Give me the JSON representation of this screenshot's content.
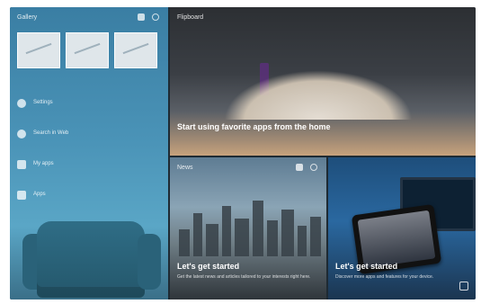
{
  "left_panel": {
    "title": "Gallery",
    "thumbnail_caption": "",
    "items": [
      {
        "label": "Settings",
        "sublabel": ""
      },
      {
        "label": "Search in Web",
        "sublabel": ""
      },
      {
        "label": "My apps",
        "sublabel": ""
      },
      {
        "label": "Apps",
        "sublabel": ""
      }
    ]
  },
  "top_panel": {
    "label": "Flipboard",
    "headline": "Start using favorite apps from the home"
  },
  "news_panel": {
    "label": "News",
    "title": "Let's get started",
    "description": "Get the latest news and articles tailored to your interests right here."
  },
  "promo_panel": {
    "title": "Let's get started",
    "description": "Discover more apps and features for your device."
  },
  "colors": {
    "frame": "#1e2a33",
    "left_panel_top": "#3a7ea3",
    "news_panel_top": "#5e7c93",
    "promo_panel_top": "#1e4e7b"
  },
  "icons": {
    "left_panel": [
      "menu-icon",
      "settings-icon"
    ],
    "news_panel": [
      "menu-icon",
      "settings-icon"
    ],
    "promo_panel": [
      "expand-icon"
    ]
  }
}
